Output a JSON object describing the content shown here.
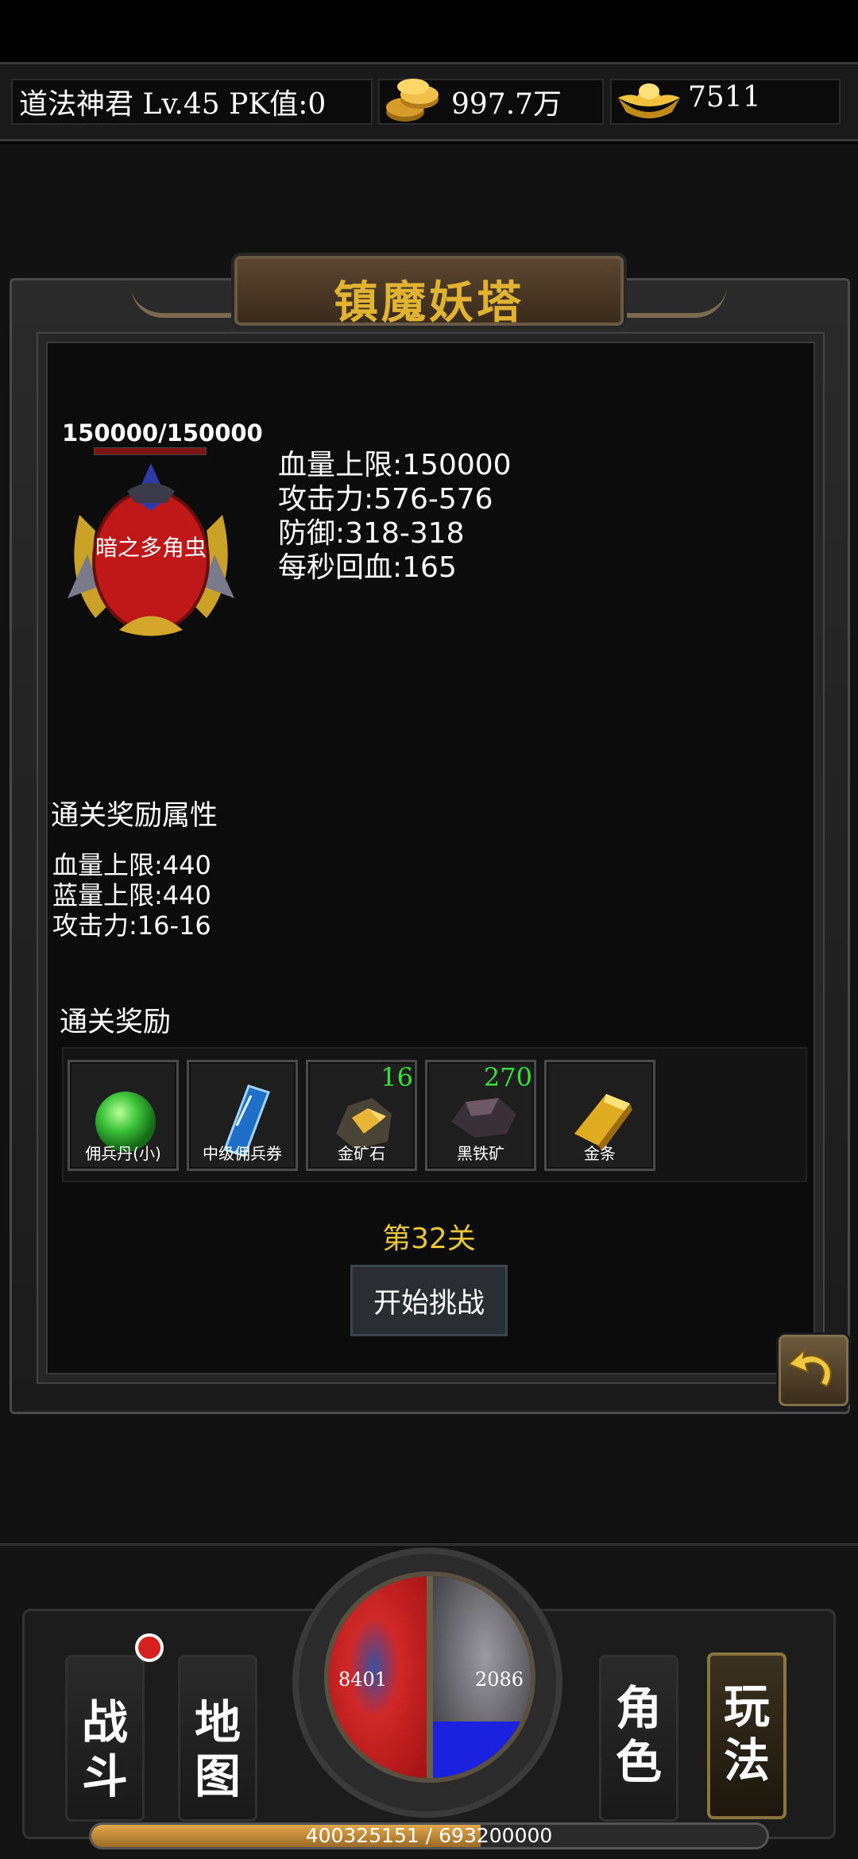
{
  "header": {
    "player": "道法神君  Lv.45 PK值:0",
    "gold_icon": "gold-coins-icon",
    "gold": "997.7万",
    "ingot_icon": "gold-ingot-icon",
    "ingot": "7511"
  },
  "panel": {
    "title": "镇魔妖塔",
    "boss": {
      "hp_text": "150000/150000",
      "hp_fraction": 1.0,
      "name": "暗之多角虫",
      "stats": [
        "血量上限:150000",
        "攻击力:576-576",
        "防御:318-318",
        "每秒回血:165"
      ]
    },
    "reward_attr_title": "通关奖励属性",
    "reward_attrs": [
      "血量上限:440",
      "蓝量上限:440",
      "攻击力:16-16"
    ],
    "reward_title": "通关奖励",
    "rewards": [
      {
        "name": "佣兵丹(小)",
        "count": "",
        "icon": "green-pill-icon"
      },
      {
        "name": "中级佣兵券",
        "count": "",
        "icon": "blue-ticket-icon"
      },
      {
        "name": "金矿石",
        "count": "16",
        "icon": "gold-ore-icon"
      },
      {
        "name": "黑铁矿",
        "count": "270",
        "icon": "black-iron-ore-icon"
      },
      {
        "name": "金条",
        "count": "",
        "icon": "gold-bar-icon"
      }
    ],
    "floor": "第32关",
    "start_button": "开始挑战"
  },
  "nav": {
    "battle": "战斗",
    "map": "地图",
    "character": "角色",
    "gameplay": "玩法",
    "active": "gameplay"
  },
  "orb": {
    "hp": "8401",
    "mp": "2086",
    "hp_fraction": 1.0,
    "mp_fraction": 0.28
  },
  "xp": {
    "text": "400325151 / 693200000",
    "fraction": 0.577
  },
  "colors": {
    "title_gold": "#e0b332",
    "floor_yellow": "#e7c63a",
    "count_green": "#35e23b",
    "hp_red": "#d02828",
    "mp_blue": "#1a22e0"
  }
}
